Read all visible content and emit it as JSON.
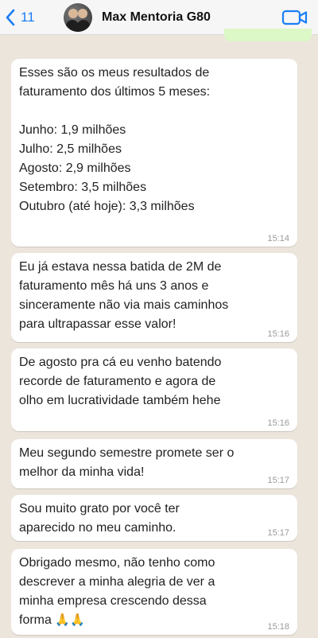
{
  "header": {
    "back_count": "11",
    "contact_name": "Max Mentoria G80"
  },
  "messages": [
    {
      "text": "Esses são os meus resultados de\nfaturamento dos últimos 5 meses:\n\nJunho: 1,9 milhões\nJulho: 2,5 milhões\nAgosto: 2,9 milhões\nSetembro: 3,5 milhões\nOutubro (até hoje): 3,3 milhões",
      "time": "15:14"
    },
    {
      "text": "Eu já estava nessa batida de 2M de\nfaturamento mês há uns 3 anos e\nsinceramente não via mais caminhos\npara ultrapassar esse valor!",
      "time": "15:16"
    },
    {
      "text": "De agosto pra cá eu venho batendo\nrecorde de faturamento e agora de\nolho em lucratividade também hehe",
      "time": "15:16"
    },
    {
      "text": "Meu segundo semestre promete ser o\nmelhor da minha vida!",
      "time": "15:17"
    },
    {
      "text": "Sou muito grato por você ter\naparecido no meu caminho.",
      "time": "15:17"
    },
    {
      "text": "Obrigado mesmo, não tenho como\ndescrever a minha alegria de ver a\nminha empresa crescendo dessa\nforma",
      "emoji": "🙏🙏",
      "time": "15:18"
    }
  ],
  "icons": {
    "back": "chevron-left-icon",
    "video": "video-camera-icon"
  },
  "colors": {
    "accent": "#1a7ef5",
    "background": "#ebe5dc",
    "bubble": "#ffffff",
    "outgoing_bubble": "#dcf8c6"
  }
}
